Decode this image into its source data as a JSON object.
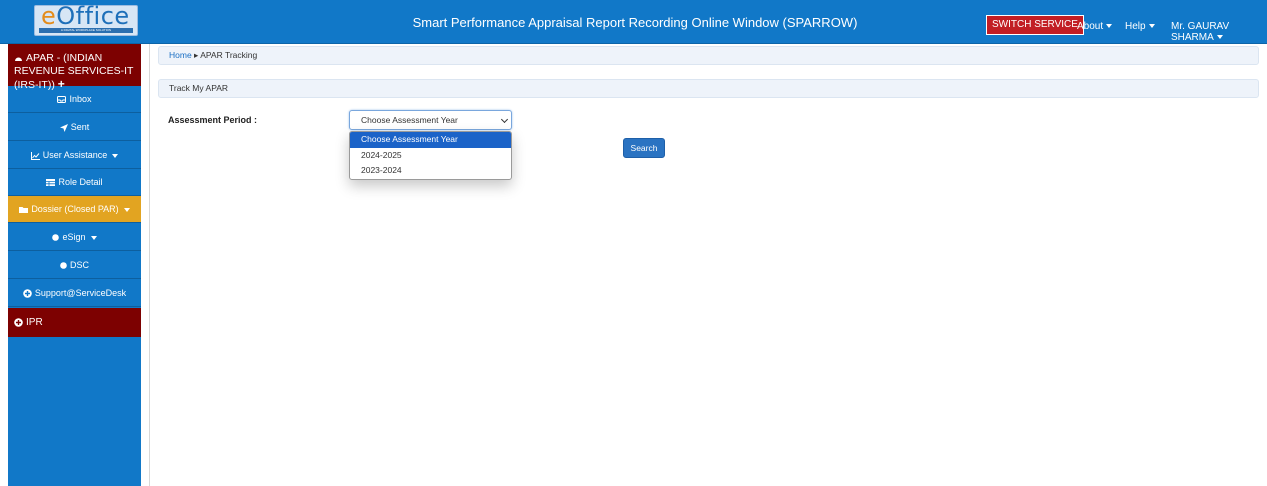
{
  "header": {
    "logo_text": "eOffice",
    "logo_tagline": "A DIGITAL WORKPLACE SOLUTION",
    "title": "Smart Performance Appraisal Report Recording Online Window (SPARROW)",
    "switch_service": "SWITCH SERVICE",
    "about": "About",
    "help": "Help",
    "user": "Mr. GAURAV SHARMA"
  },
  "sidebar": {
    "head": "APAR - (INDIAN REVENUE SERVICES-IT (IRS-IT))",
    "items": [
      {
        "label": "Inbox",
        "icon": "inbox-icon"
      },
      {
        "label": "Sent",
        "icon": "send-icon"
      },
      {
        "label": "User Assistance",
        "icon": "chart-icon"
      },
      {
        "label": "Role Detail",
        "icon": "table-icon"
      },
      {
        "label": "Dossier (Closed PAR)",
        "icon": "folder-icon"
      },
      {
        "label": "eSign",
        "icon": "circle-icon"
      },
      {
        "label": "DSC",
        "icon": "circle-icon"
      },
      {
        "label": "Support@ServiceDesk",
        "icon": "plus-circle-icon"
      }
    ],
    "ipr": "IPR"
  },
  "breadcrumb": {
    "home": "Home",
    "current": "APAR Tracking"
  },
  "panel_title": "Track My APAR",
  "form": {
    "label": "Assessment Period :",
    "selected": "Choose Assessment Year",
    "options": [
      "Choose Assessment Year",
      "2024-2025",
      "2023-2024"
    ],
    "search": "Search"
  },
  "colors": {
    "primary": "#1178c8",
    "maroon": "#7d0101",
    "active": "#e2a421",
    "danger": "#c21e25"
  }
}
